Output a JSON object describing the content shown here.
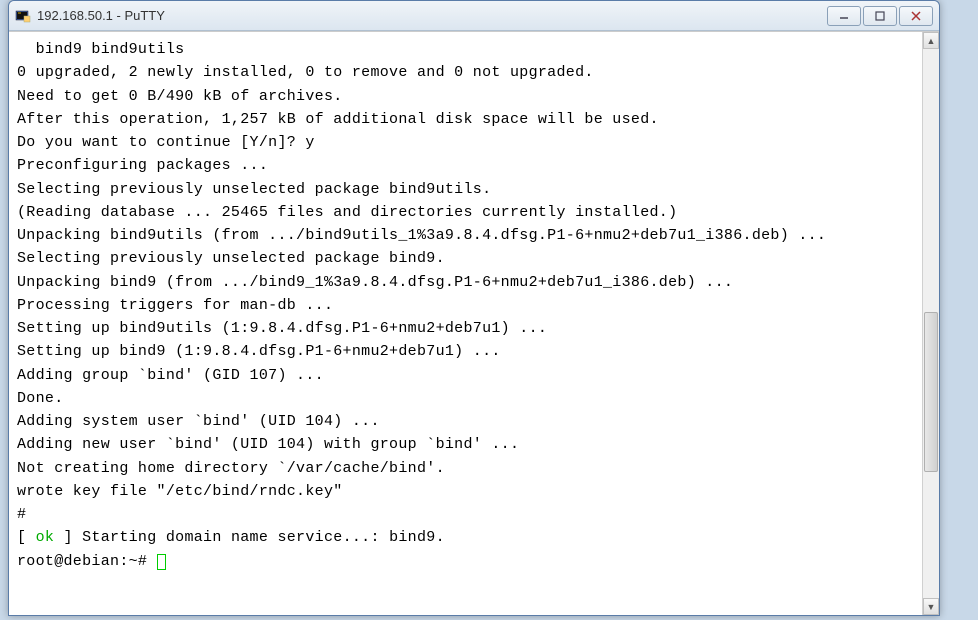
{
  "window": {
    "title": "192.168.50.1 - PuTTY"
  },
  "terminal": {
    "lines": [
      "  bind9 bind9utils",
      "0 upgraded, 2 newly installed, 0 to remove and 0 not upgraded.",
      "Need to get 0 B/490 kB of archives.",
      "After this operation, 1,257 kB of additional disk space will be used.",
      "Do you want to continue [Y/n]? y",
      "Preconfiguring packages ...",
      "Selecting previously unselected package bind9utils.",
      "(Reading database ... 25465 files and directories currently installed.)",
      "Unpacking bind9utils (from .../bind9utils_1%3a9.8.4.dfsg.P1-6+nmu2+deb7u1_i386.deb) ...",
      "Selecting previously unselected package bind9.",
      "Unpacking bind9 (from .../bind9_1%3a9.8.4.dfsg.P1-6+nmu2+deb7u1_i386.deb) ...",
      "Processing triggers for man-db ...",
      "Setting up bind9utils (1:9.8.4.dfsg.P1-6+nmu2+deb7u1) ...",
      "Setting up bind9 (1:9.8.4.dfsg.P1-6+nmu2+deb7u1) ...",
      "Adding group `bind' (GID 107) ...",
      "Done.",
      "Adding system user `bind' (UID 104) ...",
      "Adding new user `bind' (UID 104) with group `bind' ...",
      "Not creating home directory `/var/cache/bind'.",
      "wrote key file \"/etc/bind/rndc.key\"",
      "#"
    ],
    "status_open": "[ ",
    "status_ok": "ok",
    "status_close": " ] Starting domain name service...: bind9.",
    "prompt": "root@debian:~# "
  }
}
